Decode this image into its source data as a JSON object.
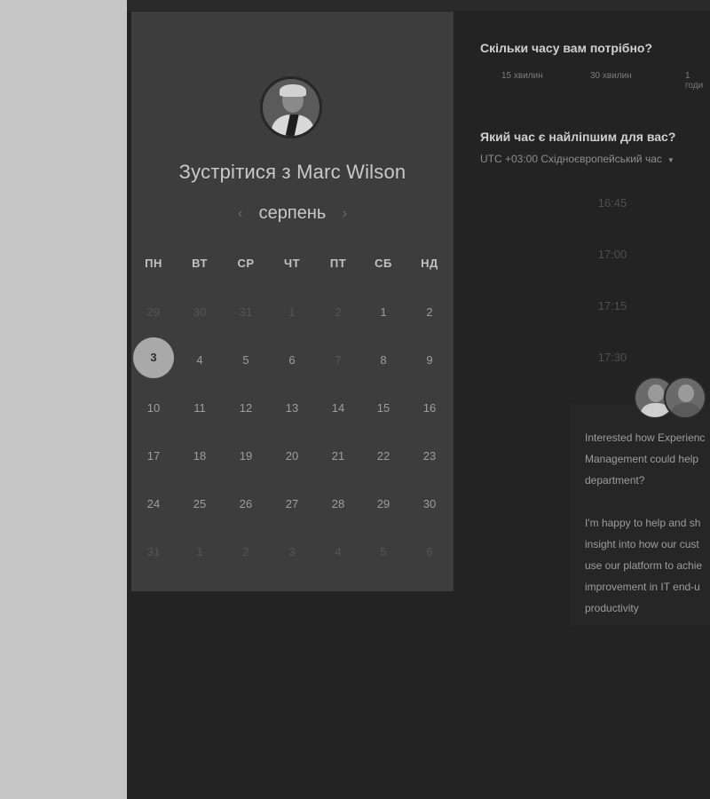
{
  "meeting": {
    "title": "Зустрітися з Marc Wilson",
    "month": "серпень",
    "prev": "‹",
    "next": "›"
  },
  "weekdays": [
    "ПН",
    "ВТ",
    "СР",
    "ЧТ",
    "ПТ",
    "СБ",
    "НД"
  ],
  "calendar": {
    "selected_day": "3",
    "weeks": [
      [
        "29",
        "30",
        "31",
        "1",
        "2",
        "1",
        "2"
      ],
      [
        "3",
        "4",
        "5",
        "6",
        "7",
        "8",
        "9"
      ],
      [
        "10",
        "11",
        "12",
        "13",
        "14",
        "15",
        "16"
      ],
      [
        "17",
        "18",
        "19",
        "20",
        "21",
        "22",
        "23"
      ],
      [
        "24",
        "25",
        "26",
        "27",
        "28",
        "29",
        "30"
      ],
      [
        "31",
        "1",
        "2",
        "3",
        "4",
        "5",
        "6"
      ]
    ]
  },
  "duration": {
    "question": "Скільки часу вам потрібно?",
    "options": [
      "15 хвилин",
      "30 хвилин",
      "1 годи"
    ]
  },
  "time": {
    "question": "Який час є найліпшим для вас?",
    "timezone": "UTC +03:00 Східноєвропейський час",
    "slots": [
      "16:45",
      "17:00",
      "17:15",
      "17:30"
    ]
  },
  "chat": {
    "message": "Interested how Experienc\nManagement could help \ndepartment?\n\nI'm happy to help and sh\ninsight into how our cust\nuse our platform to achie\nimprovement in IT end-u\nproductivity"
  },
  "colors": {
    "background": "#232323",
    "panel": "#3d3d3d",
    "selected_day": "#a9a9a9",
    "left_gutter": "#c6c6c6"
  }
}
